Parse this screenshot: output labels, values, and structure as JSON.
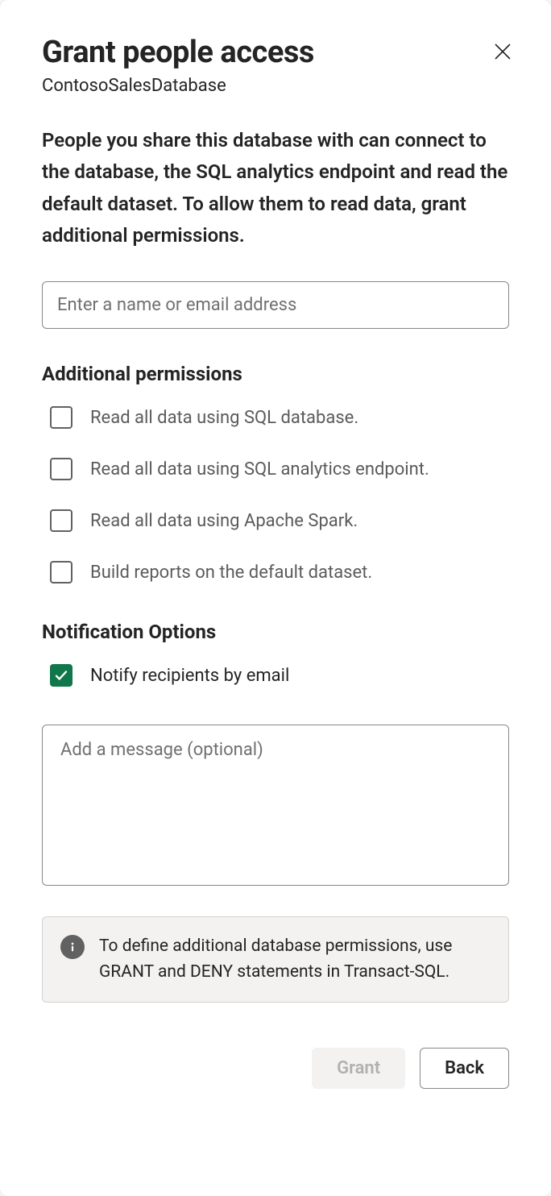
{
  "header": {
    "title": "Grant people access",
    "subtitle": "ContosoSalesDatabase"
  },
  "description": "People you share this database with can connect to the database, the SQL analytics endpoint and read the default dataset. To allow them to read data, grant additional permissions.",
  "name_input": {
    "placeholder": "Enter a name or email address",
    "value": ""
  },
  "additional_permissions": {
    "heading": "Additional permissions",
    "items": [
      {
        "label": "Read all data using SQL database.",
        "checked": false
      },
      {
        "label": "Read all data using SQL analytics endpoint.",
        "checked": false
      },
      {
        "label": "Read all data using Apache Spark.",
        "checked": false
      },
      {
        "label": "Build reports on the default dataset.",
        "checked": false
      }
    ]
  },
  "notification": {
    "heading": "Notification Options",
    "notify_label": "Notify recipients by email",
    "notify_checked": true,
    "message_placeholder": "Add a message (optional)",
    "message_value": ""
  },
  "info": {
    "text": "To define additional database permissions, use GRANT and DENY statements in Transact-SQL."
  },
  "footer": {
    "grant_label": "Grant",
    "back_label": "Back"
  }
}
